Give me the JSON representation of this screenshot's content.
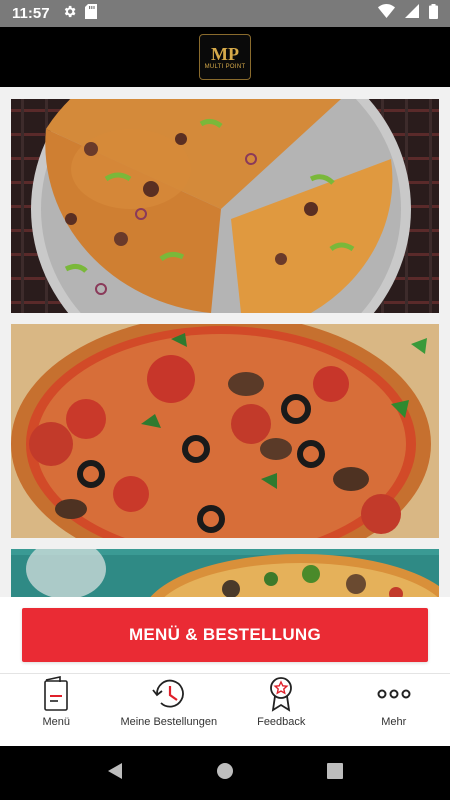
{
  "status_bar": {
    "time": "11:57",
    "icons_left": [
      "settings-gear-icon",
      "sd-card-icon"
    ],
    "icons_right": [
      "wifi-icon",
      "cellular-signal-icon",
      "battery-icon"
    ]
  },
  "header": {
    "logo_monogram": "MP",
    "logo_text": "MULTI POINT"
  },
  "promos": [
    {
      "icon": "pizza-image-pepper-beef"
    },
    {
      "icon": "pizza-image-pepperoni-mushroom"
    },
    {
      "icon": "pizza-image-partial"
    }
  ],
  "cta": {
    "label": "MENÜ & BESTELLUNG"
  },
  "bottom_nav": {
    "items": [
      {
        "label": "Menü",
        "icon": "menu-book-icon"
      },
      {
        "label": "Meine Bestellungen",
        "icon": "history-icon"
      },
      {
        "label": "Feedback",
        "icon": "award-badge-icon"
      },
      {
        "label": "Mehr",
        "icon": "more-dots-icon"
      }
    ]
  },
  "colors": {
    "accent": "#ea2b34",
    "header_bg": "#000000",
    "status_bar_bg": "#7a7a7a"
  }
}
